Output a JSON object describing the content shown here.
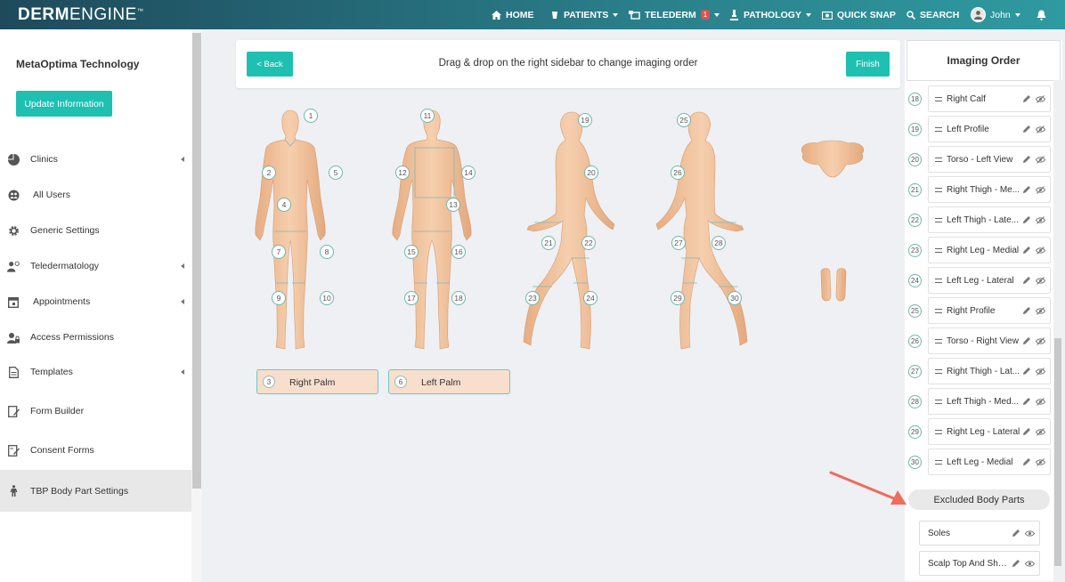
{
  "app": {
    "logo_bold": "DERM",
    "logo_light": "ENGINE",
    "logo_tm": "™"
  },
  "nav": {
    "home": "HOME",
    "patients": "PATIENTS",
    "telederm": "TELEDERM",
    "telederm_badge": "1",
    "pathology": "PATHOLOGY",
    "quick_snap": "QUICK SNAP",
    "search": "SEARCH",
    "user": "John"
  },
  "sidebar": {
    "org_name": "MetaOptima Technology",
    "update_button": "Update Information",
    "items": [
      {
        "label": "Clinics",
        "icon": "pie-chart-icon",
        "has_submenu": true
      },
      {
        "label": "All Users",
        "icon": "users-icon",
        "has_submenu": false
      },
      {
        "label": "Generic Settings",
        "icon": "gear-icon",
        "has_submenu": false
      },
      {
        "label": "Teledermatology",
        "icon": "doctor-icon",
        "has_submenu": true
      },
      {
        "label": "Appointments",
        "icon": "calendar-icon",
        "has_submenu": true
      },
      {
        "label": "Access Permissions",
        "icon": "lock-user-icon",
        "has_submenu": false
      },
      {
        "label": "Templates",
        "icon": "document-icon",
        "has_submenu": true
      },
      {
        "label": "Form Builder",
        "icon": "form-edit-icon",
        "has_submenu": false
      },
      {
        "label": "Consent Forms",
        "icon": "consent-form-icon",
        "has_submenu": false
      },
      {
        "label": "TBP Body Part Settings",
        "icon": "body-icon",
        "has_submenu": false,
        "active": true
      }
    ]
  },
  "header": {
    "back_button": "< Back",
    "instruction": "Drag & drop on the right sidebar to change imaging order",
    "finish_button": "Finish"
  },
  "body_map": {
    "labels": [
      "1",
      "2",
      "4",
      "5",
      "7",
      "8",
      "9",
      "10",
      "11",
      "12",
      "13",
      "14",
      "15",
      "16",
      "17",
      "18",
      "19",
      "20",
      "21",
      "22",
      "23",
      "24",
      "25",
      "26",
      "27",
      "28",
      "29",
      "30"
    ],
    "palms": [
      {
        "number": "3",
        "label": "Right Palm"
      },
      {
        "number": "6",
        "label": "Left Palm"
      }
    ]
  },
  "imaging_order": {
    "title": "Imaging Order",
    "items": [
      {
        "number": "18",
        "label": "Right Calf"
      },
      {
        "number": "19",
        "label": "Left Profile"
      },
      {
        "number": "20",
        "label": "Torso - Left View"
      },
      {
        "number": "21",
        "label": "Right Thigh - Me..."
      },
      {
        "number": "22",
        "label": "Left Thigh - Late..."
      },
      {
        "number": "23",
        "label": "Right Leg - Medial"
      },
      {
        "number": "24",
        "label": "Left Leg - Lateral"
      },
      {
        "number": "25",
        "label": "Right Profile"
      },
      {
        "number": "26",
        "label": "Torso - Right View"
      },
      {
        "number": "27",
        "label": "Right Thigh - Lat..."
      },
      {
        "number": "28",
        "label": "Left Thigh - Med..."
      },
      {
        "number": "29",
        "label": "Right Leg - Lateral"
      },
      {
        "number": "30",
        "label": "Left Leg - Medial"
      }
    ]
  },
  "excluded": {
    "title": "Excluded Body Parts",
    "items": [
      {
        "label": "Soles"
      },
      {
        "label": "Scalp Top And Sho..."
      }
    ]
  },
  "colors": {
    "teal": "#1ec0b2",
    "skin": "#f2c49e",
    "annotation_arrow": "#ee6c5b"
  }
}
